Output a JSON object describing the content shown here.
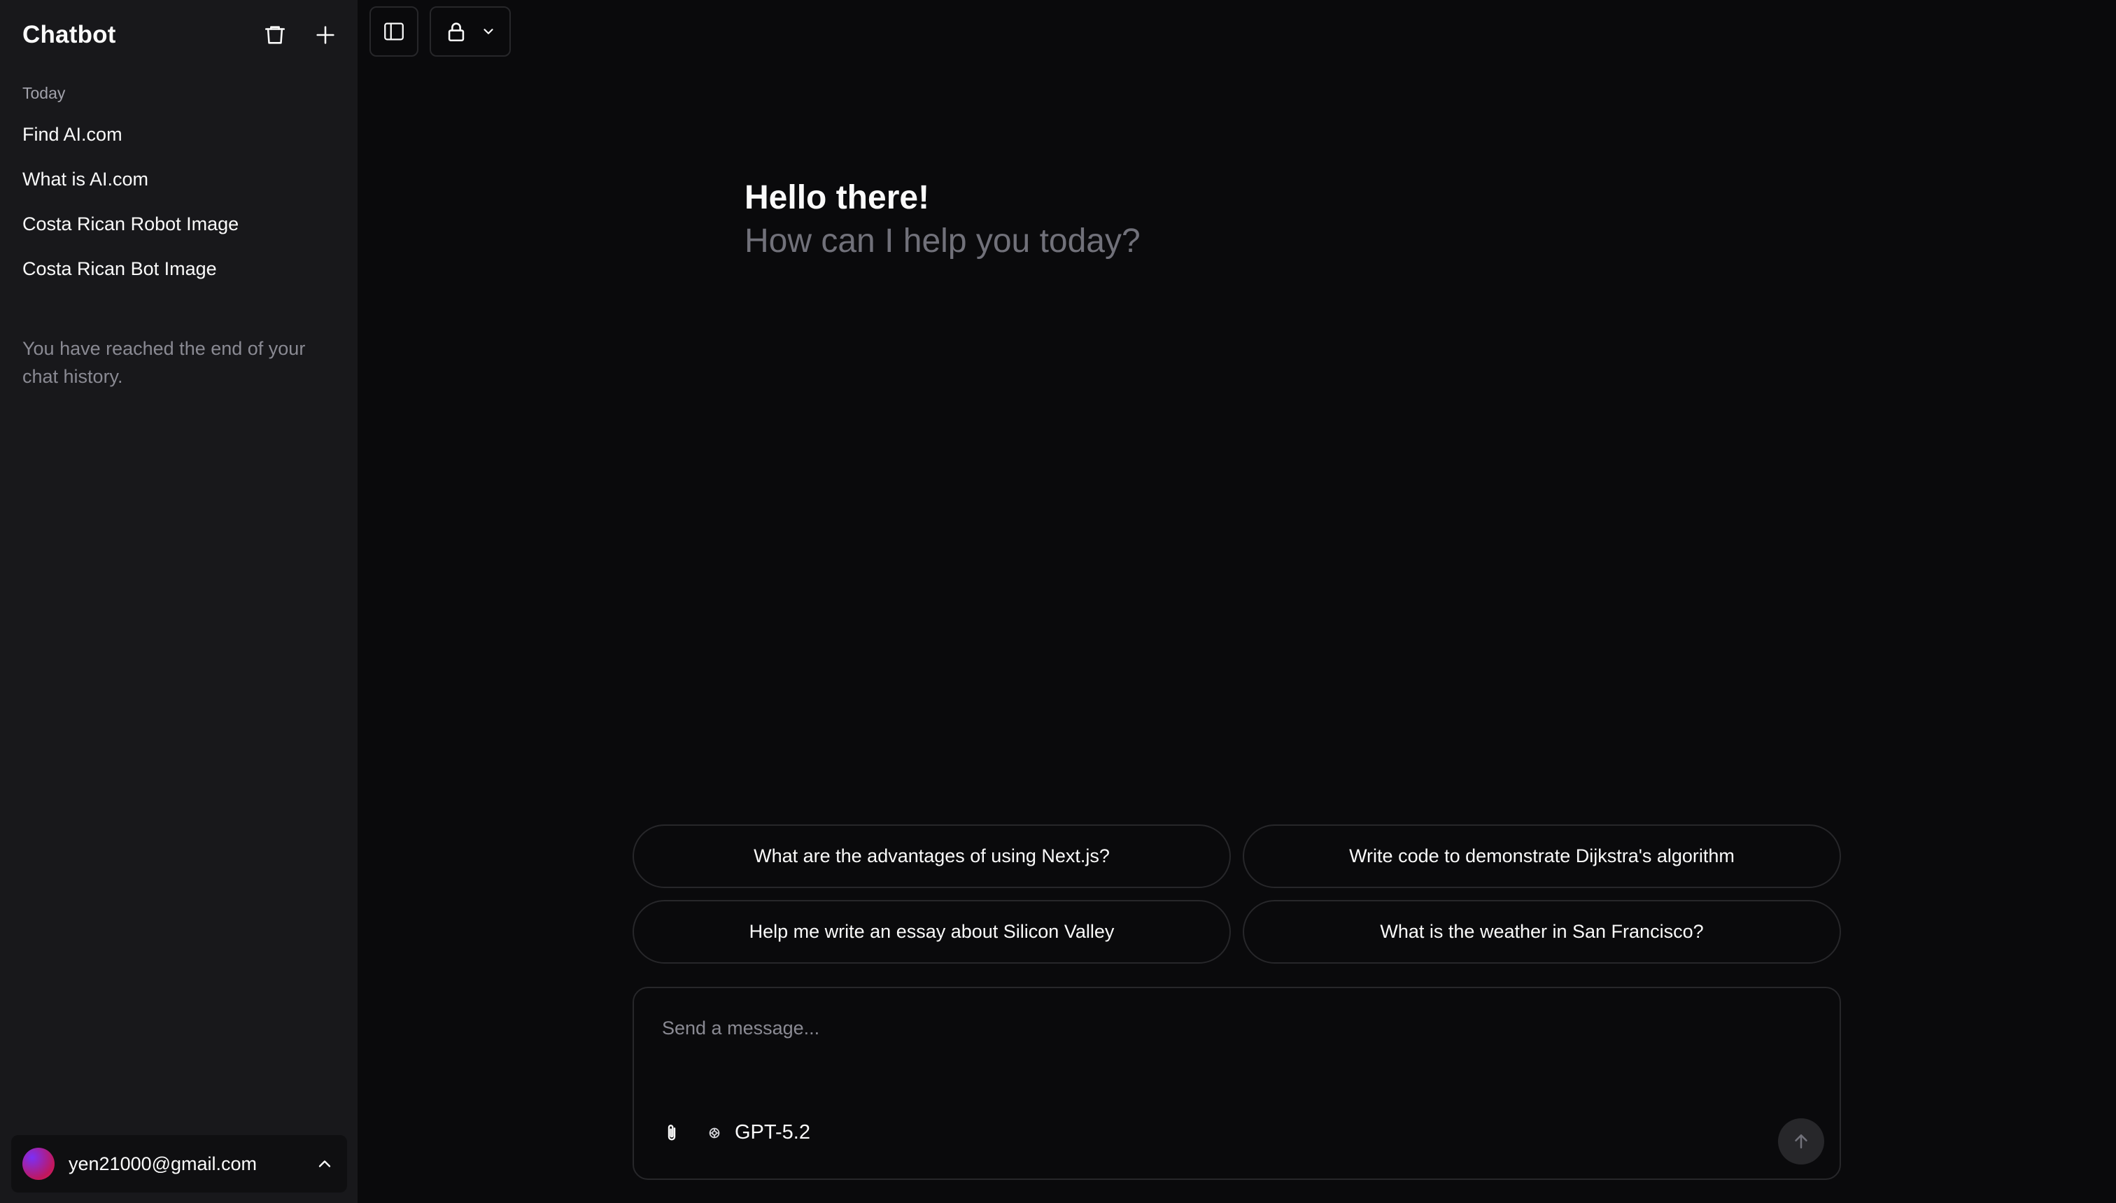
{
  "sidebar": {
    "title": "Chatbot",
    "section_label": "Today",
    "items": [
      {
        "label": "Find AI.com"
      },
      {
        "label": "What is AI.com"
      },
      {
        "label": "Costa Rican Robot Image"
      },
      {
        "label": "Costa Rican Bot Image"
      }
    ],
    "end_message": "You have reached the end of your chat history.",
    "user_email": "yen21000@gmail.com"
  },
  "greeting": {
    "title": "Hello there!",
    "subtitle": "How can I help you today?"
  },
  "suggestions": [
    {
      "label": "What are the advantages of using Next.js?"
    },
    {
      "label": "Write code to demonstrate Dijkstra's algorithm"
    },
    {
      "label": "Help me write an essay about Silicon Valley"
    },
    {
      "label": "What is the weather in San Francisco?"
    }
  ],
  "composer": {
    "placeholder": "Send a message...",
    "model_name": "GPT-5.2"
  },
  "icons": {
    "delete": "trash-icon",
    "new_chat": "plus-icon",
    "sidebar_toggle": "sidebar-toggle-icon",
    "visibility": "lock-icon",
    "attach": "paperclip-icon",
    "model": "openai-icon",
    "send": "arrow-up-icon",
    "user_menu": "chevron-up-icon"
  },
  "colors": {
    "background": "#0a0a0c",
    "sidebar": "#18181b",
    "border": "#27272a",
    "muted_text": "#71717a"
  }
}
